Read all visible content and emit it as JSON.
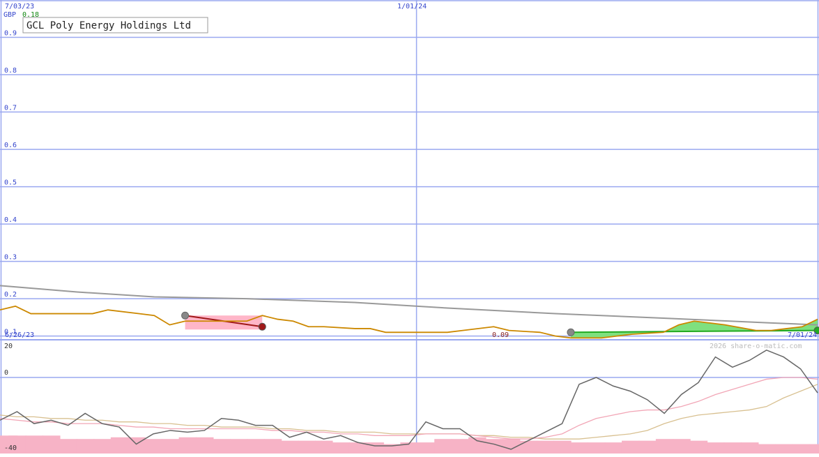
{
  "header": {
    "date_left": "7/03/23",
    "date_mid": "1/01/24",
    "currency": "GBP",
    "last_price": "0.18",
    "company": "GCL Poly Energy Holdings Ltd"
  },
  "footer": {
    "date_left": "6/26/23",
    "date_right": "7/01/24",
    "low_price": "0.09",
    "watermark": "2026 share-o-matic.com"
  },
  "colors": {
    "grid": "#9aa8f0",
    "price": "#cc8800",
    "ma_long": "#999999",
    "buy_fill": "#7fe07f",
    "buy_line": "#22aa22",
    "sell_fill": "#ffb6c8",
    "sell_line": "#a01818",
    "osc_line": "#666666",
    "osc_pink": "#f2a6b6",
    "osc_tan": "#d8c090",
    "histogram": "#f7b3c6"
  },
  "chart_data": [
    {
      "type": "line",
      "title": "GCL Poly Energy Holdings Ltd",
      "ylabel": "GBP",
      "ylim": [
        0.09,
        1.0
      ],
      "yticks": [
        0.1,
        0.2,
        0.3,
        0.4,
        0.5,
        0.6,
        0.7,
        0.8,
        0.9
      ],
      "ytick_labels": [
        "0.1",
        "0.2",
        "0.3",
        "0.4",
        "0.5",
        "0.6",
        "0.7",
        "0.8",
        "0.9"
      ],
      "xlim": [
        "2023-06-26",
        "2024-07-01"
      ],
      "x_markers": [
        {
          "date": "2024-01-01",
          "label": "1/01/24"
        }
      ],
      "grid": true,
      "series": [
        {
          "role": "price",
          "x": [
            "2023-06-26",
            "2023-07-03",
            "2023-07-10",
            "2023-07-24",
            "2023-08-07",
            "2023-08-14",
            "2023-08-28",
            "2023-09-04",
            "2023-09-11",
            "2023-09-18",
            "2023-10-02",
            "2023-10-09",
            "2023-10-16",
            "2023-10-23",
            "2023-10-30",
            "2023-11-06",
            "2023-11-13",
            "2023-11-20",
            "2023-12-04",
            "2023-12-11",
            "2023-12-18",
            "2024-01-01",
            "2024-01-15",
            "2024-01-22",
            "2024-02-05",
            "2024-02-12",
            "2024-02-26",
            "2024-03-04",
            "2024-03-11",
            "2024-03-25",
            "2024-04-01",
            "2024-04-08",
            "2024-04-22",
            "2024-04-29",
            "2024-05-06",
            "2024-05-13",
            "2024-05-20",
            "2024-06-03",
            "2024-06-10",
            "2024-06-17",
            "2024-06-24",
            "2024-07-01"
          ],
          "values": [
            0.17,
            0.18,
            0.16,
            0.16,
            0.16,
            0.17,
            0.16,
            0.155,
            0.13,
            0.14,
            0.14,
            0.14,
            0.14,
            0.155,
            0.145,
            0.14,
            0.125,
            0.125,
            0.12,
            0.12,
            0.11,
            0.11,
            0.11,
            0.115,
            0.125,
            0.115,
            0.11,
            0.1,
            0.095,
            0.095,
            0.1,
            0.105,
            0.11,
            0.13,
            0.14,
            0.135,
            0.13,
            0.115,
            0.115,
            0.12,
            0.125,
            0.145
          ]
        },
        {
          "role": "moving-average",
          "x": [
            "2023-06-26",
            "2023-07-31",
            "2023-09-04",
            "2023-10-16",
            "2023-12-04",
            "2024-01-15",
            "2024-03-04",
            "2024-04-22",
            "2024-06-10",
            "2024-07-01"
          ],
          "values": [
            0.235,
            0.218,
            0.205,
            0.2,
            0.19,
            0.175,
            0.16,
            0.148,
            0.135,
            0.13
          ]
        }
      ],
      "trades": [
        {
          "kind": "sell",
          "entry": {
            "x": "2023-09-18",
            "y": 0.155
          },
          "exit": {
            "x": "2023-10-23",
            "y": 0.125
          }
        },
        {
          "kind": "buy",
          "entry": {
            "x": "2024-03-11",
            "y": 0.11
          },
          "exit": {
            "x": "2024-07-01",
            "y": 0.115
          }
        }
      ],
      "annotations": [
        "7/03/23",
        "1/01/24",
        "0.18",
        "0.09"
      ]
    },
    {
      "type": "line",
      "ylim": [
        -40,
        20
      ],
      "yticks": [
        20,
        0,
        -40
      ],
      "ytick_labels": [
        "20",
        "0",
        "-40"
      ],
      "xlim": [
        "2023-06-26",
        "2024-07-01"
      ],
      "x_labels": [
        "6/26/23",
        "7/01/24"
      ],
      "grid": true,
      "series": [
        {
          "role": "oscillator",
          "values": [
            -25,
            -20,
            -27,
            -25,
            -28,
            -21,
            -27,
            -29,
            -39,
            -33,
            -31,
            -32,
            -31,
            -24,
            -25,
            -28,
            -28,
            -35,
            -32,
            -36,
            -34,
            -38,
            -40,
            -40,
            -39,
            -26,
            -30,
            -30,
            -37,
            -39,
            -42,
            -37,
            -32,
            -27,
            -4,
            0,
            -5,
            -8,
            -13,
            -21,
            -10,
            -3,
            12,
            6,
            10,
            16,
            12,
            5,
            -9
          ]
        },
        {
          "role": "signal-fast",
          "values": [
            -24,
            -25,
            -26,
            -26,
            -27,
            -27,
            -27,
            -28,
            -29,
            -29,
            -30,
            -30,
            -30,
            -30,
            -30,
            -30,
            -31,
            -31,
            -32,
            -32,
            -33,
            -33,
            -34,
            -34,
            -34,
            -33,
            -33,
            -33,
            -34,
            -35,
            -36,
            -36,
            -35,
            -33,
            -28,
            -24,
            -22,
            -20,
            -19,
            -19,
            -17,
            -14,
            -10,
            -7,
            -4,
            -1,
            0,
            0,
            -1
          ]
        },
        {
          "role": "signal-slow",
          "values": [
            -22,
            -23,
            -23,
            -24,
            -24,
            -25,
            -25,
            -26,
            -26,
            -27,
            -27,
            -28,
            -28,
            -29,
            -29,
            -29,
            -30,
            -30,
            -31,
            -31,
            -32,
            -32,
            -32,
            -33,
            -33,
            -33,
            -33,
            -33,
            -34,
            -34,
            -35,
            -35,
            -36,
            -36,
            -36,
            -35,
            -34,
            -33,
            -31,
            -27,
            -24,
            -22,
            -21,
            -20,
            -19,
            -17,
            -12,
            -8,
            -4
          ]
        },
        {
          "role": "histogram",
          "values": [
            -34,
            -34,
            -34,
            -34,
            -36,
            -36,
            -36,
            -35,
            -35,
            -36,
            -36,
            -35,
            -35,
            -36,
            -36,
            -36,
            -36,
            -37,
            -37,
            -37,
            -38,
            -38,
            -38,
            -39,
            -38,
            -38,
            -36,
            -36,
            -35,
            -36,
            -36,
            -37,
            -37,
            -37,
            -38,
            -38,
            -38,
            -37,
            -37,
            -36,
            -36,
            -37,
            -38,
            -38,
            -38,
            -39,
            -39,
            -39,
            -39
          ]
        }
      ]
    }
  ]
}
